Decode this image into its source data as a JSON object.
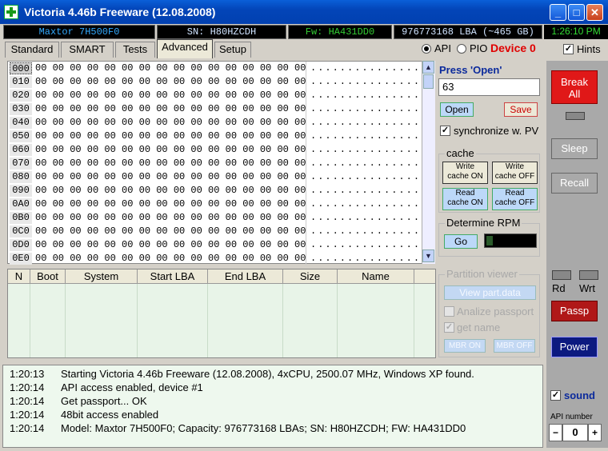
{
  "window": {
    "title": "Victoria 4.46b Freeware (12.08.2008)",
    "min": "_",
    "max": "□",
    "close": "✕"
  },
  "status": {
    "model": "Maxtor 7H500F0",
    "serial": "SN: H80HZCDH",
    "firmware": "Fw: HA431DD0",
    "capacity": "976773168 LBA (~465 GB)",
    "clock": "1:26:10 PM"
  },
  "tabs": [
    "Standard",
    "SMART",
    "Tests",
    "Advanced",
    "Setup"
  ],
  "mode": {
    "api": "API",
    "pio": "PIO",
    "device": "Device 0",
    "hints": "Hints"
  },
  "hex": {
    "rows": [
      "000",
      "010",
      "020",
      "030",
      "040",
      "050",
      "060",
      "070",
      "080",
      "090",
      "0A0",
      "0B0",
      "0C0",
      "0D0",
      "0E0"
    ],
    "bytes": "00 00 00 00 00 00 00 00 00 00 00 00 00 00 00 00",
    "ascii": "................"
  },
  "right": {
    "press_open": "Press 'Open'",
    "input_value": "63",
    "open": "Open",
    "save": "Save",
    "sync": "synchronize w. PV",
    "cache_title": "cache",
    "write_on": [
      "Write",
      "cache ON"
    ],
    "write_off": [
      "Write",
      "cache OFF"
    ],
    "read_on": [
      "Read",
      "cache ON"
    ],
    "read_off": [
      "Read",
      "cache OFF"
    ],
    "rpm_title": "Determine RPM",
    "go": "Go",
    "partition_title": "Partition viewer",
    "view_partdata": "View part.data",
    "analyze": "Analize passport",
    "getname": "get name",
    "mbr_on": "MBR ON",
    "mbr_off": "MBR OFF"
  },
  "side": {
    "break_all": [
      "Break",
      "All"
    ],
    "sleep": "Sleep",
    "recall": "Recall",
    "rd": "Rd",
    "wrt": "Wrt",
    "passp": "Passp",
    "power": "Power",
    "sound": "sound",
    "api_number": "API number",
    "api_value": "0",
    "minus": "−",
    "plus": "+"
  },
  "partition_headers": [
    "N",
    "Boot",
    "System",
    "Start LBA",
    "End LBA",
    "Size",
    "Name"
  ],
  "log": [
    {
      "time": "1:20:13",
      "msg": "Starting Victoria 4.46b Freeware (12.08.2008), 4xCPU, 2500.07 MHz, Windows XP found."
    },
    {
      "time": "1:20:14",
      "msg": "API access enabled, device #1"
    },
    {
      "time": "1:20:14",
      "msg": "Get passport... OK"
    },
    {
      "time": "1:20:14",
      "msg": "48bit access enabled"
    },
    {
      "time": "1:20:14",
      "msg": "Model: Maxtor 7H500F0; Capacity: 976773168 LBAs; SN: H80HZCDH; FW: HA431DD0"
    }
  ],
  "colors": {
    "title_bar": "#0345b8",
    "status_text": "#33aaff",
    "clock_text": "#33dd33",
    "device_red": "#e00000",
    "break_red": "#e01818",
    "passp_red": "#b01818",
    "power_navy": "#0c1a80"
  }
}
